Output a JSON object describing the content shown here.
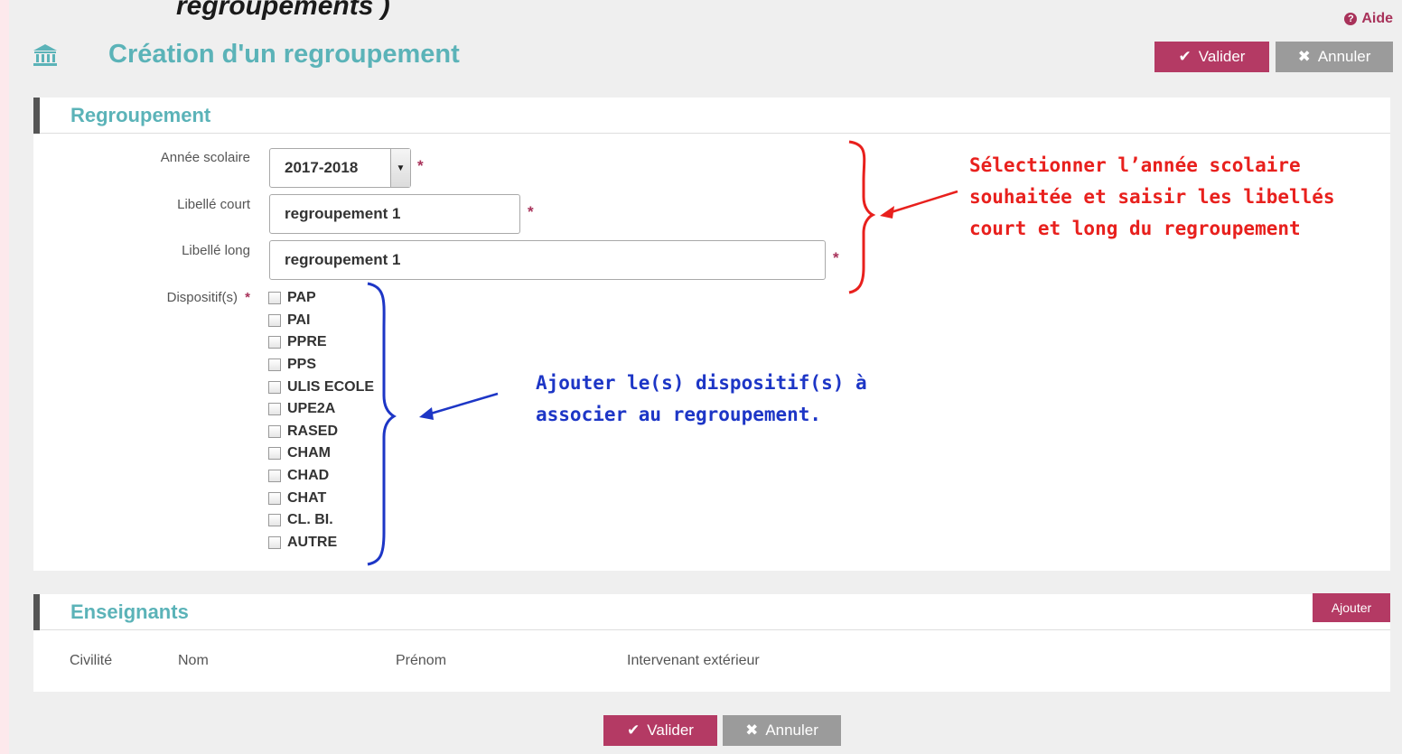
{
  "header": {
    "clipped_text": "regroupements )",
    "help": "Aide",
    "title": "Création d'un regroupement",
    "valider": "Valider",
    "annuler": "Annuler"
  },
  "regroupement": {
    "title": "Regroupement",
    "annee_label": "Année scolaire",
    "annee_value": "2017-2018",
    "court_label": "Libellé court",
    "court_value": "regroupement 1",
    "long_label": "Libellé long",
    "long_value": "regroupement 1",
    "dispositifs_label": "Dispositif(s)",
    "required": "*",
    "dispositifs": [
      "PAP",
      "PAI",
      "PPRE",
      "PPS",
      "ULIS ECOLE",
      "UPE2A",
      "RASED",
      "CHAM",
      "CHAD",
      "CHAT",
      "CL. BI.",
      "AUTRE"
    ]
  },
  "enseignants": {
    "title": "Enseignants",
    "ajouter": "Ajouter",
    "columns": [
      "Civilité",
      "Nom",
      "Prénom",
      "Intervenant extérieur"
    ]
  },
  "footer": {
    "valider": "Valider",
    "annuler": "Annuler"
  },
  "annotations": {
    "red_lines": [
      "Sélectionner l’année scolaire",
      "souhaitée et saisir les libellés",
      "court et long du regroupement"
    ],
    "blue_lines": [
      "Ajouter le(s) dispositif(s) à",
      "associer au regroupement."
    ]
  },
  "colors": {
    "accent": "#b43a64",
    "title": "#5bb3b8",
    "annot_red": "#e8201d",
    "annot_blue": "#1d36c6"
  }
}
